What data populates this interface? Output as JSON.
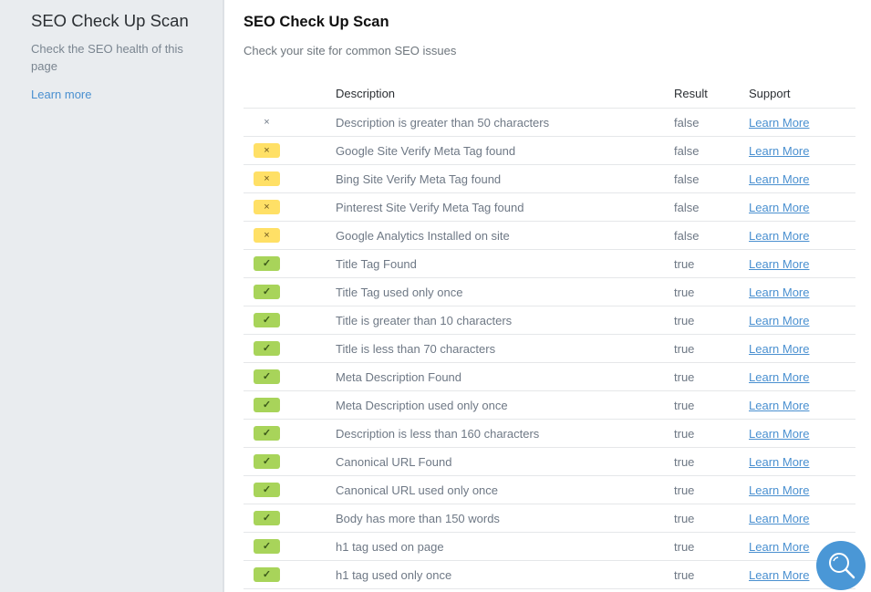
{
  "sidebar": {
    "title": "SEO Check Up Scan",
    "description": "Check the SEO health of this page",
    "learn_more": "Learn more"
  },
  "main": {
    "title": "SEO Check Up Scan",
    "subtitle": "Check your site for common SEO issues",
    "columns": {
      "status": "",
      "description": "Description",
      "result": "Result",
      "support": "Support"
    },
    "rows": [
      {
        "status": "warning",
        "icon": "x-icon",
        "description": "Description is greater than 50 characters",
        "result": "false",
        "support": "Learn More"
      },
      {
        "status": "fail",
        "icon": "x-icon",
        "description": "Google Site Verify Meta Tag found",
        "result": "false",
        "support": "Learn More"
      },
      {
        "status": "fail",
        "icon": "x-icon",
        "description": "Bing Site Verify Meta Tag found",
        "result": "false",
        "support": "Learn More"
      },
      {
        "status": "fail",
        "icon": "x-icon",
        "description": "Pinterest Site Verify Meta Tag found",
        "result": "false",
        "support": "Learn More"
      },
      {
        "status": "fail",
        "icon": "x-icon",
        "description": "Google Analytics Installed on site",
        "result": "false",
        "support": "Learn More"
      },
      {
        "status": "pass",
        "icon": "check-icon",
        "description": "Title Tag Found",
        "result": "true",
        "support": "Learn More"
      },
      {
        "status": "pass",
        "icon": "check-icon",
        "description": "Title Tag used only once",
        "result": "true",
        "support": "Learn More"
      },
      {
        "status": "pass",
        "icon": "check-icon",
        "description": "Title is greater than 10 characters",
        "result": "true",
        "support": "Learn More"
      },
      {
        "status": "pass",
        "icon": "check-icon",
        "description": "Title is less than 70 characters",
        "result": "true",
        "support": "Learn More"
      },
      {
        "status": "pass",
        "icon": "check-icon",
        "description": "Meta Description Found",
        "result": "true",
        "support": "Learn More"
      },
      {
        "status": "pass",
        "icon": "check-icon",
        "description": "Meta Description used only once",
        "result": "true",
        "support": "Learn More"
      },
      {
        "status": "pass",
        "icon": "check-icon",
        "description": "Description is less than 160 characters",
        "result": "true",
        "support": "Learn More"
      },
      {
        "status": "pass",
        "icon": "check-icon",
        "description": "Canonical URL Found",
        "result": "true",
        "support": "Learn More"
      },
      {
        "status": "pass",
        "icon": "check-icon",
        "description": "Canonical URL used only once",
        "result": "true",
        "support": "Learn More"
      },
      {
        "status": "pass",
        "icon": "check-icon",
        "description": "Body has more than 150 words",
        "result": "true",
        "support": "Learn More"
      },
      {
        "status": "pass",
        "icon": "check-icon",
        "description": "h1 tag used on page",
        "result": "true",
        "support": "Learn More"
      },
      {
        "status": "pass",
        "icon": "check-icon",
        "description": "h1 tag used only once",
        "result": "true",
        "support": "Learn More"
      }
    ]
  },
  "icons": {
    "x": "×",
    "check": "✓"
  },
  "fab": {
    "icon": "search-icon"
  },
  "colors": {
    "accent": "#4a90d0",
    "warning": "#f2c47f",
    "fail": "#ffe066",
    "pass": "#a8d45a",
    "fab": "#4a97d6"
  }
}
